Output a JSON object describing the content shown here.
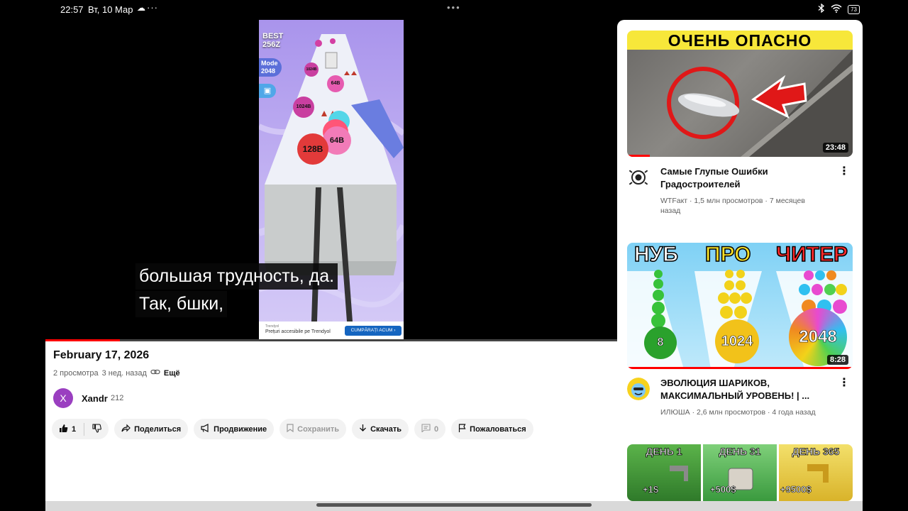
{
  "status_bar": {
    "time": "22:57",
    "date": "Вт, 10 Мар",
    "more": "···",
    "center_dots": "•••",
    "battery": "73",
    "icons": [
      "cloud-icon",
      "bluetooth-icon",
      "wifi-icon",
      "battery-icon"
    ]
  },
  "player": {
    "game": {
      "best_label": "BEST",
      "best_value": "256Z",
      "mode_label": "Mode",
      "mode_value": "2048",
      "balls": [
        "1024B",
        "64B",
        "1024B",
        "128B",
        "64B"
      ],
      "ad": {
        "brand": "Trendyol",
        "text": "Prețuri accesibile pe Trendyol",
        "cta": "CUMPĂRAȚI ACUM ›"
      }
    },
    "captions": [
      "большая трудность, да.",
      "Так, бшки,"
    ],
    "progress": 0.13,
    "colors": {
      "progress": "#ff0000"
    }
  },
  "video": {
    "title": "February 17, 2026",
    "views": "2 просмотра",
    "age": "3 нед. назад",
    "more_label": "Ещё",
    "channel": {
      "avatar_letter": "X",
      "name": "Xandr",
      "subscribers": "212",
      "avatar_color": "#9a3fc0"
    },
    "actions": {
      "like_count": "1",
      "share": "Поделиться",
      "promote": "Продвижение",
      "save": "Сохранить",
      "download": "Скачать",
      "comments": "0",
      "report": "Пожаловаться"
    }
  },
  "recommendations": [
    {
      "thumb_text": "ОЧЕНЬ ОПАСНО",
      "duration": "23:48",
      "watched": 0.1,
      "title_line1": "Самые Глупые Ошибки",
      "title_line2": "Градостроителей",
      "meta_line1": "WTFакт · 1,5 млн просмотров · 7 месяцев",
      "meta_line2": "назад"
    },
    {
      "thumb_words": [
        "НУБ",
        "ПРО",
        "ЧИТЕР"
      ],
      "thumb_balls": [
        "8",
        "1024",
        "2048"
      ],
      "duration": "8:28",
      "watched": 1.0,
      "title_line1": "ЭВОЛЮЦИЯ ШАРИКОВ,",
      "title_line2": "МАКСИМАЛЬНЫЙ УРОВЕНЬ! | ...",
      "meta_line1": "ИЛЮША · 2,6 млн просмотров · 4 года назад"
    },
    {
      "thumb_labels": [
        "ДЕНЬ 1",
        "ДЕНЬ 31",
        "ДЕНЬ 365"
      ],
      "thumb_values": [
        "+1$",
        "+500$",
        "+9500$"
      ]
    }
  ]
}
